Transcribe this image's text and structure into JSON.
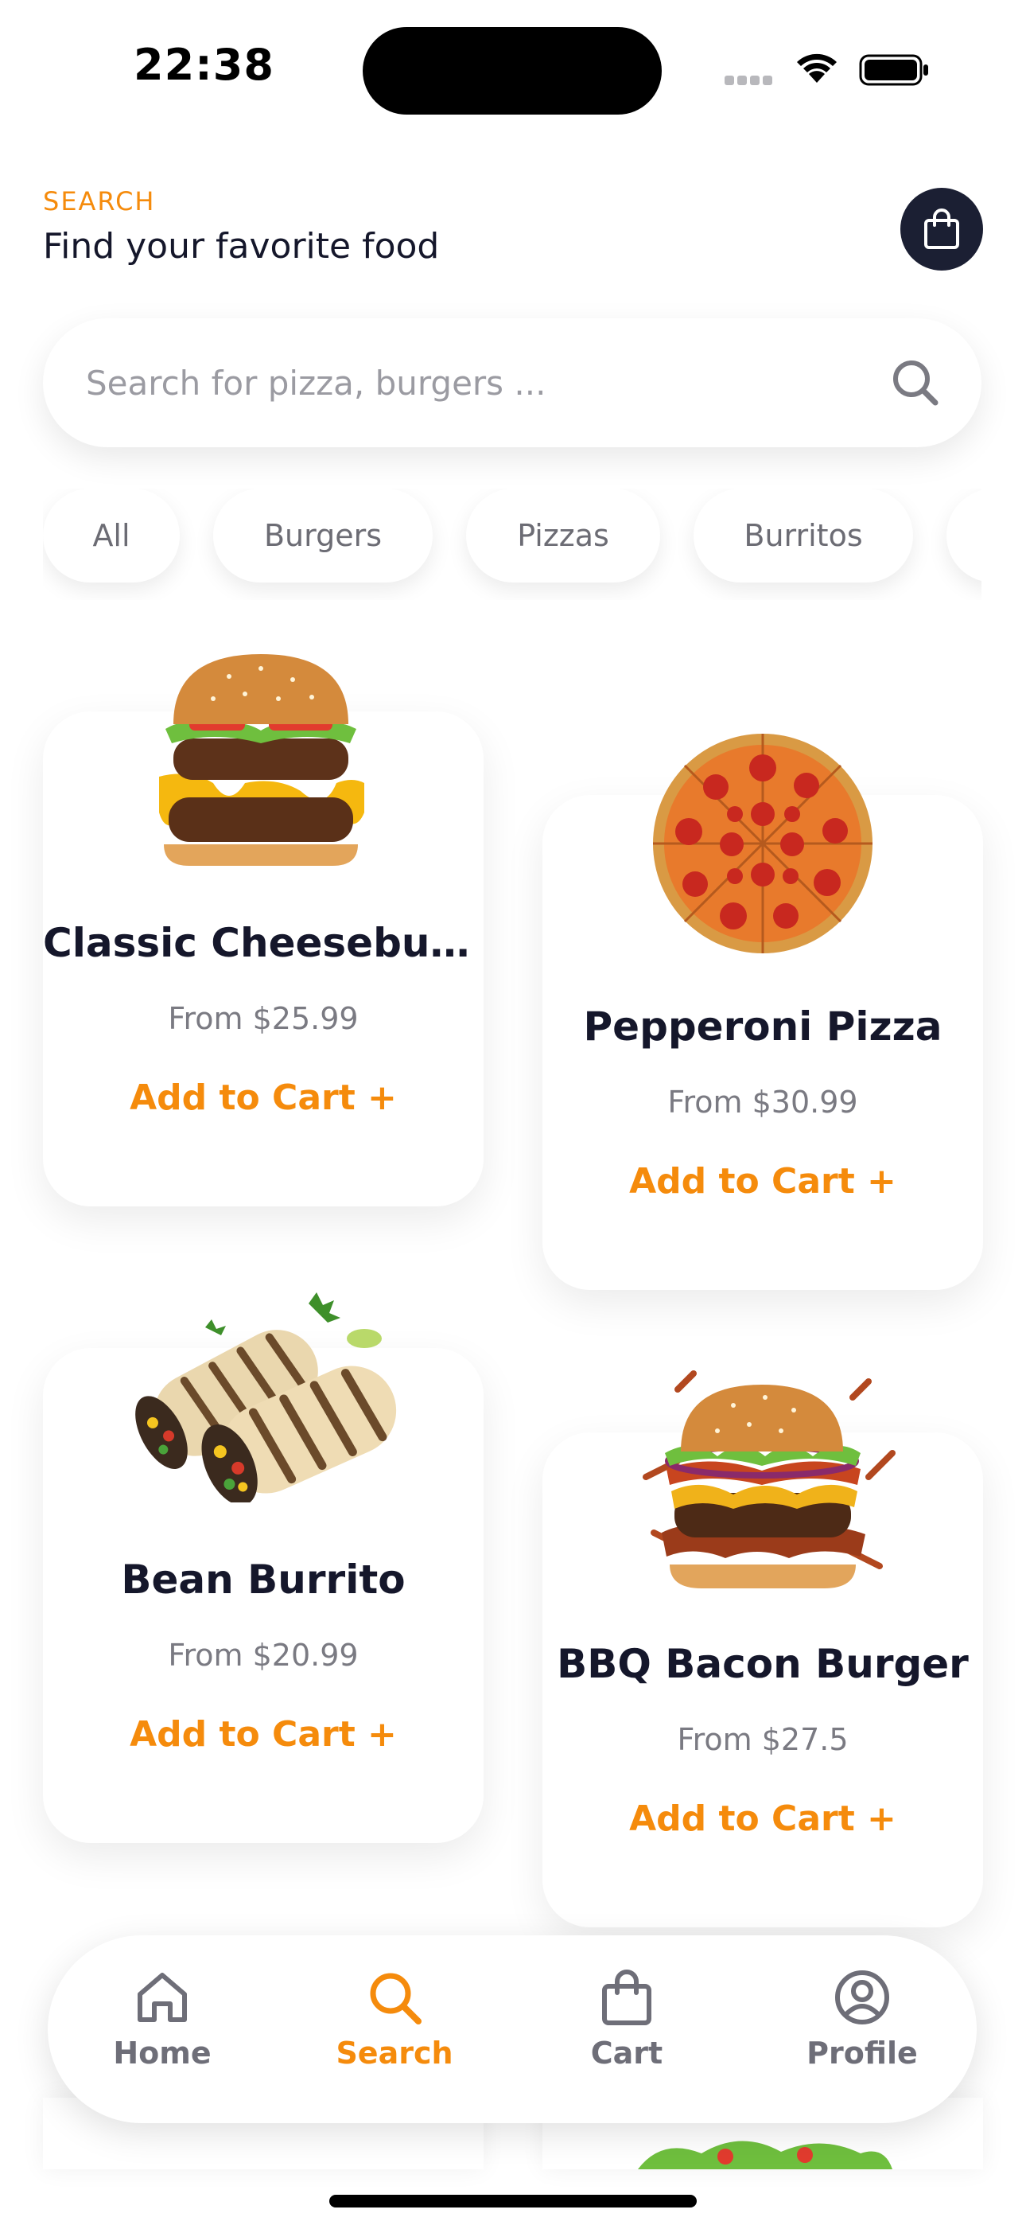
{
  "status_bar": {
    "time": "22:38"
  },
  "header": {
    "eyebrow": "SEARCH",
    "title": "Find your favorite food"
  },
  "search": {
    "placeholder": "Search for pizza, burgers ...",
    "value": ""
  },
  "categories": [
    "All",
    "Burgers",
    "Pizzas",
    "Burritos",
    ""
  ],
  "products": [
    {
      "name": "Classic Cheeseburger",
      "price": "From $25.99",
      "cta": "Add to Cart +",
      "image": "cheeseburger-image"
    },
    {
      "name": "Pepperoni Pizza",
      "price": "From $30.99",
      "cta": "Add to Cart +",
      "image": "pepperoni-pizza-image"
    },
    {
      "name": "Bean Burrito",
      "price": "From $20.99",
      "cta": "Add to Cart +",
      "image": "bean-burrito-image"
    },
    {
      "name": "BBQ Bacon Burger",
      "price": "From $27.5",
      "cta": "Add to Cart +",
      "image": "bbq-bacon-burger-image"
    }
  ],
  "tabs": [
    {
      "label": "Home",
      "icon": "home-icon",
      "active": false
    },
    {
      "label": "Search",
      "icon": "search-icon",
      "active": true
    },
    {
      "label": "Cart",
      "icon": "bag-icon",
      "active": false
    },
    {
      "label": "Profile",
      "icon": "profile-icon",
      "active": false
    }
  ],
  "colors": {
    "accent": "#f58b0c",
    "dark": "#15172b",
    "inactive": "#6e6e78",
    "muted": "#7a7a82"
  }
}
